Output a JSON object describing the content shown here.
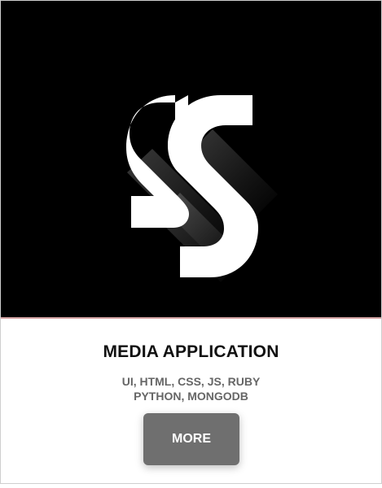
{
  "card": {
    "title": "MEDIA APPLICATION",
    "tags_line1": "UI, HTML, CSS, JS, RUBY",
    "tags_line2": "PYTHON, MONGODB",
    "button_label": "MORE"
  },
  "theme": {
    "hero_background": "#000000",
    "logo_color": "#ffffff",
    "button_background": "#6f6f6f",
    "title_color": "#111111",
    "tags_color": "#666666"
  },
  "icons": {
    "logo": "double-s-logo-icon"
  }
}
